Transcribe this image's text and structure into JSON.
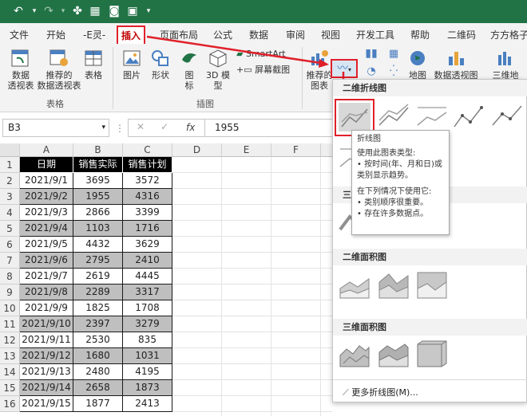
{
  "qat": {
    "icons": [
      "undo-icon",
      "redo-icon",
      "macro-icon",
      "calculator-icon",
      "camera-icon",
      "form-icon"
    ]
  },
  "tabs": [
    "文件",
    "开始",
    "-E灵-",
    "插入",
    "页面布局",
    "公式",
    "数据",
    "审阅",
    "视图",
    "开发工具",
    "帮助",
    "二维码",
    "方方格子"
  ],
  "active_tab": "插入",
  "ribbon": {
    "pivot_table": "数据\n透视表",
    "recommended_pivot": "推荐的\n数据透视表",
    "table": "表格",
    "group_tables": "表格",
    "picture": "图片",
    "shape": "形状",
    "icon": "图\n标",
    "model3d": "3D 模\n型",
    "smartart": "SmartArt",
    "screenshot": "屏幕截图",
    "group_illustrations": "插图",
    "recommended_charts": "推荐的\n图表",
    "map": "地图",
    "pivot_chart": "数据透视图",
    "three_d_map": "三维地"
  },
  "formula_bar": {
    "namebox": "B3",
    "fx": "fx",
    "value": "1955"
  },
  "columns": [
    "A",
    "B",
    "C",
    "D",
    "E",
    "F"
  ],
  "table": {
    "headers": [
      "日期",
      "销售实际",
      "销售计划"
    ],
    "rows": [
      [
        "2021/9/1",
        "3695",
        "3572"
      ],
      [
        "2021/9/2",
        "1955",
        "4316"
      ],
      [
        "2021/9/3",
        "2866",
        "3399"
      ],
      [
        "2021/9/4",
        "1103",
        "1716"
      ],
      [
        "2021/9/5",
        "4432",
        "3629"
      ],
      [
        "2021/9/6",
        "2795",
        "2410"
      ],
      [
        "2021/9/7",
        "2619",
        "4445"
      ],
      [
        "2021/9/8",
        "2289",
        "3317"
      ],
      [
        "2021/9/9",
        "1825",
        "1708"
      ],
      [
        "2021/9/10",
        "2397",
        "3279"
      ],
      [
        "2021/9/11",
        "2530",
        "835"
      ],
      [
        "2021/9/12",
        "1680",
        "1031"
      ],
      [
        "2021/9/13",
        "2480",
        "4195"
      ],
      [
        "2021/9/14",
        "2658",
        "1873"
      ],
      [
        "2021/9/15",
        "1877",
        "2413"
      ]
    ]
  },
  "row_numbers": [
    "1",
    "2",
    "3",
    "4",
    "5",
    "6",
    "7",
    "8",
    "9",
    "10",
    "11",
    "12",
    "13",
    "14",
    "15",
    "16"
  ],
  "dropdown": {
    "section_2d_line": "二维折线图",
    "section_3d_line_partial": "三",
    "section_2d_area": "二维面积图",
    "section_3d_area": "三维面积图",
    "more_link": "更多折线图(M)..."
  },
  "tooltip": {
    "title": "折线图",
    "line1": "使用此图表类型:",
    "line2": "• 按时间(年、月和日)或类别显示趋势。",
    "line3": "在下列情况下使用它:",
    "line4": "• 类别顺序很重要。",
    "line5": "• 存在许多数据点。"
  },
  "colors": {
    "excel_green": "#217346",
    "highlight_red": "#e0202a"
  }
}
